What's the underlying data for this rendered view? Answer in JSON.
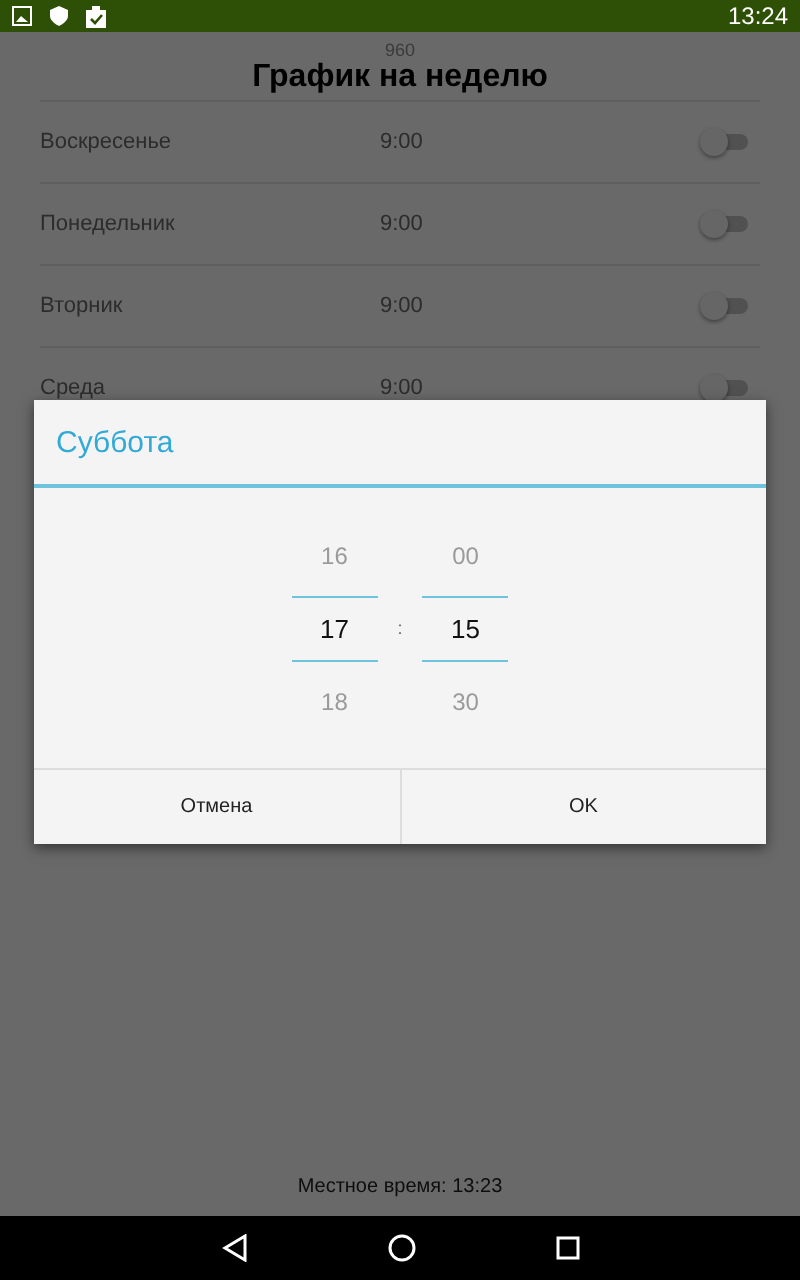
{
  "status_bar": {
    "time": "13:24"
  },
  "header": {
    "caption": "960",
    "title": "График на неделю"
  },
  "days": [
    {
      "name": "Воскресенье",
      "time": "9:00",
      "on": false
    },
    {
      "name": "Понедельник",
      "time": "9:00",
      "on": false
    },
    {
      "name": "Вторник",
      "time": "9:00",
      "on": false
    },
    {
      "name": "Среда",
      "time": "9:00",
      "on": false
    }
  ],
  "dialog": {
    "title": "Суббота",
    "separator": ":",
    "hours": [
      {
        "value": "16",
        "selected": false
      },
      {
        "value": "17",
        "selected": true
      },
      {
        "value": "18",
        "selected": false
      }
    ],
    "minutes": [
      {
        "value": "00",
        "selected": false
      },
      {
        "value": "15",
        "selected": true
      },
      {
        "value": "30",
        "selected": false
      }
    ],
    "buttons": [
      "Отмена",
      "OK"
    ]
  },
  "footer": {
    "text": "Местное время: 13:23"
  }
}
